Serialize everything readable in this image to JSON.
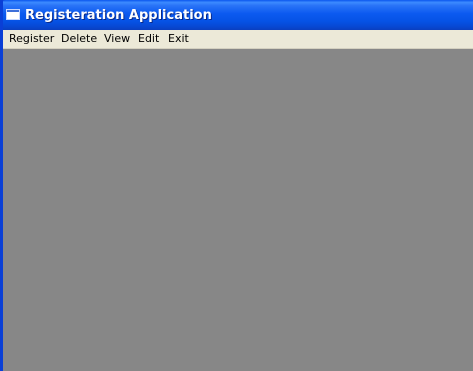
{
  "window": {
    "title": "Registeration Application",
    "icon": "window-app-icon",
    "colors": {
      "titlebar": "#0c5af0",
      "menubar": "#ece9d8",
      "client_area": "#878787"
    }
  },
  "menubar": {
    "items": [
      {
        "label": "Register"
      },
      {
        "label": "Delete"
      },
      {
        "label": "View"
      },
      {
        "label": "Edit"
      },
      {
        "label": "Exit"
      }
    ]
  }
}
